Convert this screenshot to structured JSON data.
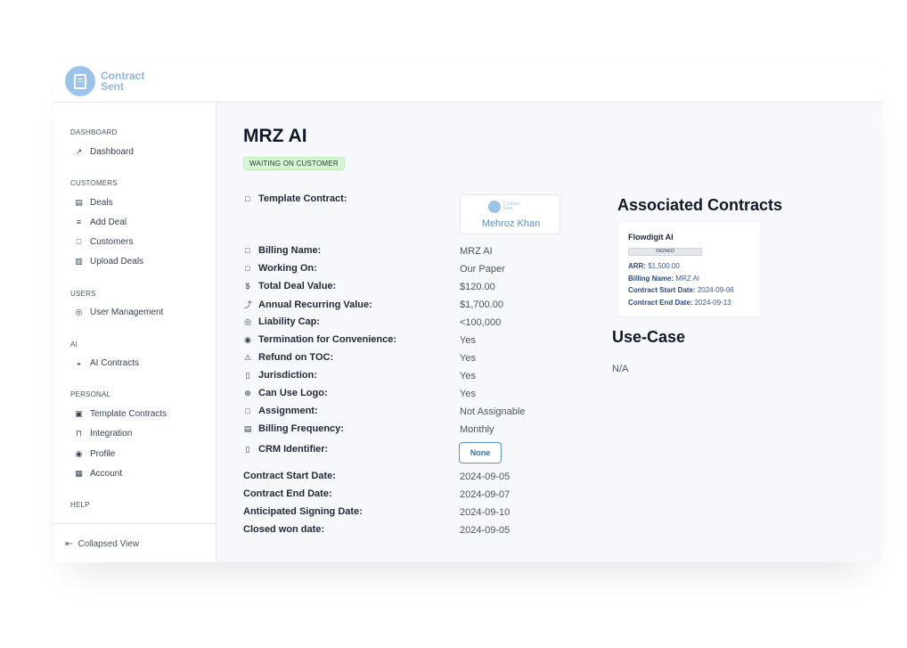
{
  "brand": {
    "name_line1": "Contract",
    "name_line2": "Sent"
  },
  "sidebar": {
    "sections": [
      {
        "label": "DASHBOARD"
      },
      {
        "label": "CUSTOMERS"
      },
      {
        "label": "USERS"
      },
      {
        "label": "AI"
      },
      {
        "label": "PERSONAL"
      },
      {
        "label": "HELP"
      }
    ],
    "items": [
      {
        "label": "Dashboard",
        "icon": "chart-icon"
      },
      {
        "label": "Deals",
        "icon": "document-icon"
      },
      {
        "label": "Add Deal",
        "icon": "add-list-icon"
      },
      {
        "label": "Customers",
        "icon": "inbox-icon"
      },
      {
        "label": "Upload Deals",
        "icon": "upload-file-icon"
      },
      {
        "label": "User Management",
        "icon": "user-circle-icon"
      },
      {
        "label": "AI Contracts",
        "icon": "robot-icon"
      },
      {
        "label": "Template Contracts",
        "icon": "template-icon"
      },
      {
        "label": "Integration",
        "icon": "plug-icon"
      },
      {
        "label": "Profile",
        "icon": "profile-icon"
      },
      {
        "label": "Account",
        "icon": "building-icon"
      }
    ],
    "collapse_label": "Collapsed View"
  },
  "deal": {
    "title": "MRZ AI",
    "status": "WAITING ON CUSTOMER",
    "template_label": "Template Contract:",
    "signature_brand": "Contract Sent",
    "signature_name": "Mehroz Khan",
    "fields": [
      {
        "label": "Billing Name:",
        "value": "MRZ AI"
      },
      {
        "label": "Working On:",
        "value": "Our Paper"
      },
      {
        "label": "Total Deal Value:",
        "value": "$120.00"
      },
      {
        "label": "Annual Recurring Value:",
        "value": "$1,700.00"
      },
      {
        "label": "Liability Cap:",
        "value": "<100,000"
      },
      {
        "label": "Termination for Convenience:",
        "value": "Yes"
      },
      {
        "label": "Refund on TOC:",
        "value": "Yes"
      },
      {
        "label": "Jurisdiction:",
        "value": "Yes"
      },
      {
        "label": "Can Use Logo:",
        "value": "Yes"
      },
      {
        "label": "Assignment:",
        "value": "Not Assignable"
      },
      {
        "label": "Billing Frequency:",
        "value": "Monthly"
      }
    ],
    "crm_label": "CRM Identifier:",
    "crm_button": "None",
    "dates": [
      {
        "label": "Contract Start Date:",
        "value": "2024-09-05"
      },
      {
        "label": "Contract End Date:",
        "value": "2024-09-07"
      },
      {
        "label": "Anticipated Signing Date:",
        "value": "2024-09-10"
      },
      {
        "label": "Closed won date:",
        "value": "2024-09-05"
      }
    ]
  },
  "associated": {
    "title": "Associated Contracts",
    "card": {
      "name": "Flowdigit AI",
      "status": "SIGNED",
      "arr_label": "ARR:",
      "arr_value": "$1,500.00",
      "billing_label": "Billing Name:",
      "billing_value": "MRZ AI",
      "start_label": "Contract Start Date:",
      "start_value": "2024-09-06",
      "end_label": "Contract End Date:",
      "end_value": "2024-09-13"
    }
  },
  "usecase": {
    "title": "Use-Case",
    "value": "N/A"
  }
}
